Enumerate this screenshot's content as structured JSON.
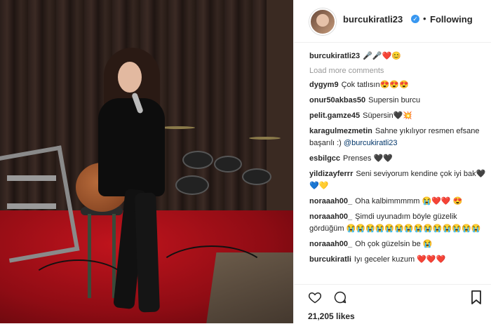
{
  "header": {
    "username": "burcukiratli23",
    "separator": "•",
    "follow_status": "Following"
  },
  "caption": {
    "username": "burcukiratli23",
    "text": "🎤🎤❤️😊"
  },
  "load_more": "Load more comments",
  "comments": [
    {
      "user": "dygym9",
      "text": "Çok tatlısın😍😍😍"
    },
    {
      "user": "onur50akbas50",
      "text": "Supersin burcu"
    },
    {
      "user": "pelit.gamze45",
      "text": "Süpersin🖤💥"
    },
    {
      "user": "karagulmezmetin",
      "text": "Sahne yıkılıyor resmen efsane başarılı :)",
      "mention": "@burcukiratli23"
    },
    {
      "user": "esbilgcc",
      "text": "Prenses 🖤🖤"
    },
    {
      "user": "yildizayferrr",
      "text": "Seni seviyorum kendine çok iyi bak🖤💙💛"
    },
    {
      "user": "noraaah00_",
      "text": "Oha kalbimmmmm 😭❤️❤️ 😍"
    },
    {
      "user": "noraaah00_",
      "text": "Şimdi uyunadım böyle güzelik gördüğüm 😭😭😭😭😭😭😭😭😭😭😭😭😭😭"
    },
    {
      "user": "noraaah00_",
      "text": "Oh çok güzelsin be 😭"
    },
    {
      "user": "burcukiratli",
      "text": "Iyı geceler kuzum ❤️❤️❤️"
    }
  ],
  "likes": "21,205 likes",
  "colors": {
    "accent": "#3897f0",
    "text": "#262626",
    "muted": "#999999"
  }
}
